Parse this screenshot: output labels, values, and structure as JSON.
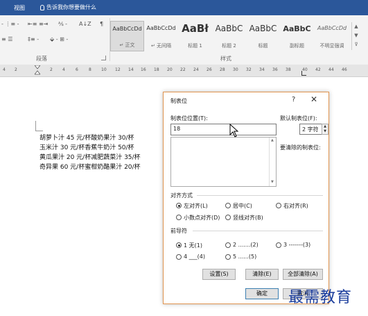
{
  "titlebar": {
    "menu_view": "视图",
    "tell_me": "告诉我你想要做什么"
  },
  "ribbon": {
    "paragraph_group": "段落",
    "styles_group": "样式",
    "styles": [
      {
        "preview": "AaBbCcDd",
        "name": "↵ 正文",
        "selected": true
      },
      {
        "preview": "AaBbCcDd",
        "name": "↵ 无间隔",
        "selected": false
      },
      {
        "preview": "AaBł",
        "name": "标题 1",
        "selected": false
      },
      {
        "preview": "AaBbC",
        "name": "标题 2",
        "selected": false
      },
      {
        "preview": "AaBbC",
        "name": "标题",
        "selected": false
      },
      {
        "preview": "AaBbC",
        "name": "副标题",
        "selected": false
      },
      {
        "preview": "AaBbCcDd",
        "name": "不明显强调",
        "selected": false
      }
    ]
  },
  "ruler": {
    "numbers": [
      "4",
      "2",
      "2",
      "4",
      "6",
      "8",
      "10",
      "12",
      "14",
      "16",
      "18",
      "20",
      "22",
      "24",
      "26",
      "28",
      "30",
      "32",
      "34",
      "36",
      "38",
      "40",
      "42",
      "44",
      "46"
    ]
  },
  "document": {
    "lines": [
      "胡萝卜汁 45 元/杯酸奶果汁 30/杯",
      "玉米汁 30 元/杯香蕉牛奶汁 50/杯",
      "黄瓜果汁 20 元/杯减肥蔬菜汁 35/杯",
      "奇异果 60 元/杯蜜柑奶酪果汁 20/杯"
    ]
  },
  "dialog": {
    "title": "制表位",
    "help": "?",
    "close": "✕",
    "tab_position_label": "制表位位置(T):",
    "tab_position_value": "18",
    "default_tab_label": "默认制表位(F):",
    "default_tab_value": "2 字符",
    "to_clear_label": "要清除的制表位:",
    "alignment_label": "对齐方式",
    "alignments": [
      "左对齐(L)",
      "居中(C)",
      "右对齐(R)",
      "小数点对齐(D)",
      "竖线对齐(B)"
    ],
    "leader_label": "前导符",
    "leaders": [
      "1 无(1)",
      "2 .......(2)",
      "3 -------(3)",
      "4 ___(4)",
      "5 ......(5)"
    ],
    "buttons": {
      "set": "设置(S)",
      "clear": "清除(E)",
      "clear_all": "全部清除(A)",
      "ok": "确定",
      "cancel": "取消"
    }
  },
  "watermark": "最需教育"
}
